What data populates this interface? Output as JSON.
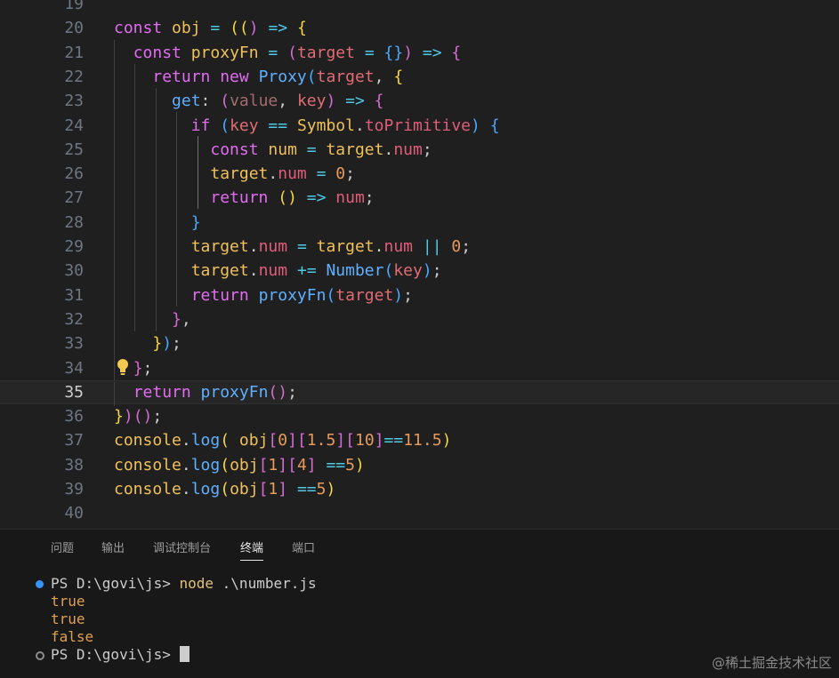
{
  "editor": {
    "active_line": "35",
    "lines": [
      {
        "num": "19"
      },
      {
        "num": "20",
        "tokens": [
          [
            "k",
            "const "
          ],
          [
            "v",
            "obj "
          ],
          [
            "op",
            "= "
          ],
          [
            "b1",
            "(("
          ],
          [
            "b2",
            ")"
          ],
          [
            "op",
            " => "
          ],
          [
            "b1",
            "{"
          ]
        ]
      },
      {
        "num": "21",
        "tokens": [
          [
            "s",
            "  "
          ],
          [
            "k",
            "const "
          ],
          [
            "v",
            "proxyFn "
          ],
          [
            "op",
            "= "
          ],
          [
            "b2",
            "("
          ],
          [
            "prm",
            "target "
          ],
          [
            "op",
            "= "
          ],
          [
            "b3",
            "{}"
          ],
          [
            "b2",
            ")"
          ],
          [
            "op",
            " => "
          ],
          [
            "b2",
            "{"
          ]
        ]
      },
      {
        "num": "22",
        "tokens": [
          [
            "s",
            "    "
          ],
          [
            "k",
            "return "
          ],
          [
            "k",
            "new "
          ],
          [
            "fn",
            "Proxy"
          ],
          [
            "b3",
            "("
          ],
          [
            "prm",
            "target"
          ],
          [
            "s",
            ", "
          ],
          [
            "b1",
            "{"
          ]
        ]
      },
      {
        "num": "23",
        "tokens": [
          [
            "s",
            "      "
          ],
          [
            "fn",
            "get"
          ],
          [
            "s",
            ": "
          ],
          [
            "b2",
            "("
          ],
          [
            "dim",
            "value"
          ],
          [
            "s",
            ", "
          ],
          [
            "prm",
            "key"
          ],
          [
            "b2",
            ")"
          ],
          [
            "op",
            " => "
          ],
          [
            "b2",
            "{"
          ]
        ]
      },
      {
        "num": "24",
        "tokens": [
          [
            "s",
            "        "
          ],
          [
            "k",
            "if "
          ],
          [
            "b3",
            "("
          ],
          [
            "prm",
            "key "
          ],
          [
            "op",
            "== "
          ],
          [
            "v",
            "Symbol"
          ],
          [
            "s",
            "."
          ],
          [
            "p",
            "toPrimitive"
          ],
          [
            "b3",
            ")"
          ],
          [
            "s",
            " "
          ],
          [
            "b3",
            "{"
          ]
        ]
      },
      {
        "num": "25",
        "tokens": [
          [
            "s",
            "          "
          ],
          [
            "k",
            "const "
          ],
          [
            "v",
            "num "
          ],
          [
            "op",
            "= "
          ],
          [
            "v",
            "target"
          ],
          [
            "s",
            "."
          ],
          [
            "p",
            "num"
          ],
          [
            "s",
            ";"
          ]
        ]
      },
      {
        "num": "26",
        "tokens": [
          [
            "s",
            "          "
          ],
          [
            "v",
            "target"
          ],
          [
            "s",
            "."
          ],
          [
            "p",
            "num "
          ],
          [
            "op",
            "= "
          ],
          [
            "n",
            "0"
          ],
          [
            "s",
            ";"
          ]
        ]
      },
      {
        "num": "27",
        "tokens": [
          [
            "s",
            "          "
          ],
          [
            "k",
            "return "
          ],
          [
            "b1",
            "()"
          ],
          [
            "op",
            " => "
          ],
          [
            "p",
            "num"
          ],
          [
            "s",
            ";"
          ]
        ]
      },
      {
        "num": "28",
        "tokens": [
          [
            "s",
            "        "
          ],
          [
            "b3",
            "}"
          ]
        ]
      },
      {
        "num": "29",
        "tokens": [
          [
            "s",
            "        "
          ],
          [
            "v",
            "target"
          ],
          [
            "s",
            "."
          ],
          [
            "p",
            "num "
          ],
          [
            "op",
            "= "
          ],
          [
            "v",
            "target"
          ],
          [
            "s",
            "."
          ],
          [
            "p",
            "num "
          ],
          [
            "op",
            "|| "
          ],
          [
            "n",
            "0"
          ],
          [
            "s",
            ";"
          ]
        ]
      },
      {
        "num": "30",
        "tokens": [
          [
            "s",
            "        "
          ],
          [
            "v",
            "target"
          ],
          [
            "s",
            "."
          ],
          [
            "p",
            "num "
          ],
          [
            "op",
            "+= "
          ],
          [
            "fn",
            "Number"
          ],
          [
            "b3",
            "("
          ],
          [
            "prm",
            "key"
          ],
          [
            "b3",
            ")"
          ],
          [
            "s",
            ";"
          ]
        ]
      },
      {
        "num": "31",
        "tokens": [
          [
            "s",
            "        "
          ],
          [
            "k",
            "return "
          ],
          [
            "fn",
            "proxyFn"
          ],
          [
            "b3",
            "("
          ],
          [
            "prm",
            "target"
          ],
          [
            "b3",
            ")"
          ],
          [
            "s",
            ";"
          ]
        ]
      },
      {
        "num": "32",
        "tokens": [
          [
            "s",
            "      "
          ],
          [
            "b2",
            "}"
          ],
          [
            "s",
            ","
          ]
        ]
      },
      {
        "num": "33",
        "tokens": [
          [
            "s",
            "    "
          ],
          [
            "b1",
            "}"
          ],
          [
            "b3",
            ")"
          ],
          [
            "s",
            ";"
          ]
        ]
      },
      {
        "num": "34",
        "tokens": [
          [
            "s",
            "  "
          ],
          [
            "b2",
            "}"
          ],
          [
            "s",
            ";"
          ]
        ]
      },
      {
        "num": "35",
        "tokens": [
          [
            "s",
            "  "
          ],
          [
            "k",
            "return "
          ],
          [
            "fn",
            "proxyFn"
          ],
          [
            "b2",
            "()"
          ],
          [
            "s",
            ";"
          ]
        ]
      },
      {
        "num": "36",
        "tokens": [
          [
            "b1",
            "}"
          ],
          [
            "b2",
            ")"
          ],
          [
            "b2",
            "()"
          ],
          [
            "s",
            ";"
          ]
        ]
      },
      {
        "num": "37",
        "tokens": [
          [
            "v",
            "console"
          ],
          [
            "s",
            "."
          ],
          [
            "fn",
            "log"
          ],
          [
            "b1",
            "( "
          ],
          [
            "v",
            "obj"
          ],
          [
            "b2",
            "["
          ],
          [
            "n",
            "0"
          ],
          [
            "b2",
            "]"
          ],
          [
            "b2",
            "["
          ],
          [
            "n",
            "1.5"
          ],
          [
            "b2",
            "]"
          ],
          [
            "b2",
            "["
          ],
          [
            "n",
            "10"
          ],
          [
            "b2",
            "]"
          ],
          [
            "op",
            "=="
          ],
          [
            "n",
            "11.5"
          ],
          [
            "b1",
            ")"
          ]
        ]
      },
      {
        "num": "38",
        "tokens": [
          [
            "v",
            "console"
          ],
          [
            "s",
            "."
          ],
          [
            "fn",
            "log"
          ],
          [
            "b1",
            "("
          ],
          [
            "v",
            "obj"
          ],
          [
            "b2",
            "["
          ],
          [
            "n",
            "1"
          ],
          [
            "b2",
            "]"
          ],
          [
            "b2",
            "["
          ],
          [
            "n",
            "4"
          ],
          [
            "b2",
            "]"
          ],
          [
            "s",
            " "
          ],
          [
            "op",
            "=="
          ],
          [
            "n",
            "5"
          ],
          [
            "b1",
            ")"
          ]
        ]
      },
      {
        "num": "39",
        "tokens": [
          [
            "v",
            "console"
          ],
          [
            "s",
            "."
          ],
          [
            "fn",
            "log"
          ],
          [
            "b1",
            "("
          ],
          [
            "v",
            "obj"
          ],
          [
            "b2",
            "["
          ],
          [
            "n",
            "1"
          ],
          [
            "b2",
            "]"
          ],
          [
            "s",
            " "
          ],
          [
            "op",
            "=="
          ],
          [
            "n",
            "5"
          ],
          [
            "b1",
            ")"
          ]
        ]
      },
      {
        "num": "40"
      }
    ]
  },
  "panel": {
    "tabs": [
      {
        "label": "问题",
        "active": false
      },
      {
        "label": "输出",
        "active": false
      },
      {
        "label": "调试控制台",
        "active": false
      },
      {
        "label": "终端",
        "active": true
      },
      {
        "label": "端口",
        "active": false
      }
    ],
    "terminal": {
      "prompt1": "PS D:\\govi\\js> ",
      "command": "node",
      "command_arg": " .\\number.js",
      "outputs": [
        "true",
        "true",
        "false"
      ],
      "prompt2": "PS D:\\govi\\js> "
    }
  },
  "watermark": "@稀土掘金技术社区",
  "colors": {
    "editor_bg": "#1f1f1f",
    "panel_bg": "#181818",
    "keyword": "#e36cf2",
    "function": "#5fb0ff",
    "variable": "#f0c05a"
  }
}
